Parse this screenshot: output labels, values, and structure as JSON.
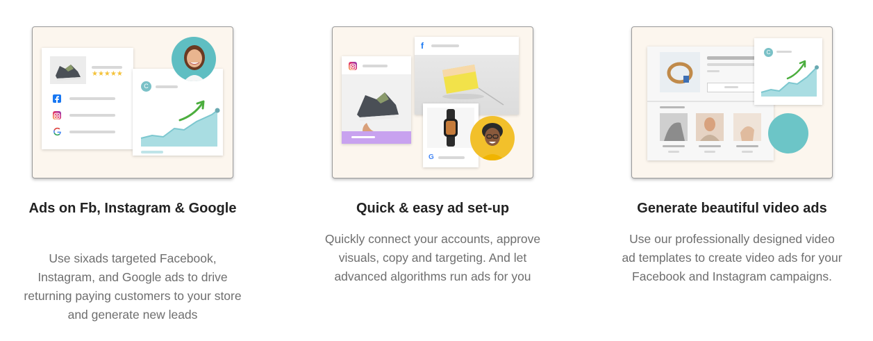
{
  "features": [
    {
      "title": "Ads on Fb, Instagram & Google",
      "description": "Use sixads targeted Facebook, Instagram, and Google ads to drive returning paying customers to your store and generate new leads",
      "stars": "★★★★★",
      "avatar_letter": "C"
    },
    {
      "title": "Quick & easy ad set-up",
      "description": "Quickly connect your accounts, approve visuals, copy and targeting. And let advanced algorithms run ads for you",
      "fb_letter": "f",
      "g_letter": "G"
    },
    {
      "title": "Generate beautiful video ads",
      "description": "Use our professionally designed video ad templates to create video ads for your Facebook and Instagram campaigns.",
      "avatar_letter": "C"
    }
  ],
  "colors": {
    "card_bg": "#fcf6ee",
    "chart_fill": "#a9dde2",
    "chart_line": "#7cc7cf",
    "arrow": "#4cae3e",
    "instagram_bar": "#c8a2ef",
    "teal_circle": "#6cc5c7",
    "yellow_circle": "#f2c02b",
    "facebook": "#1877f2"
  }
}
